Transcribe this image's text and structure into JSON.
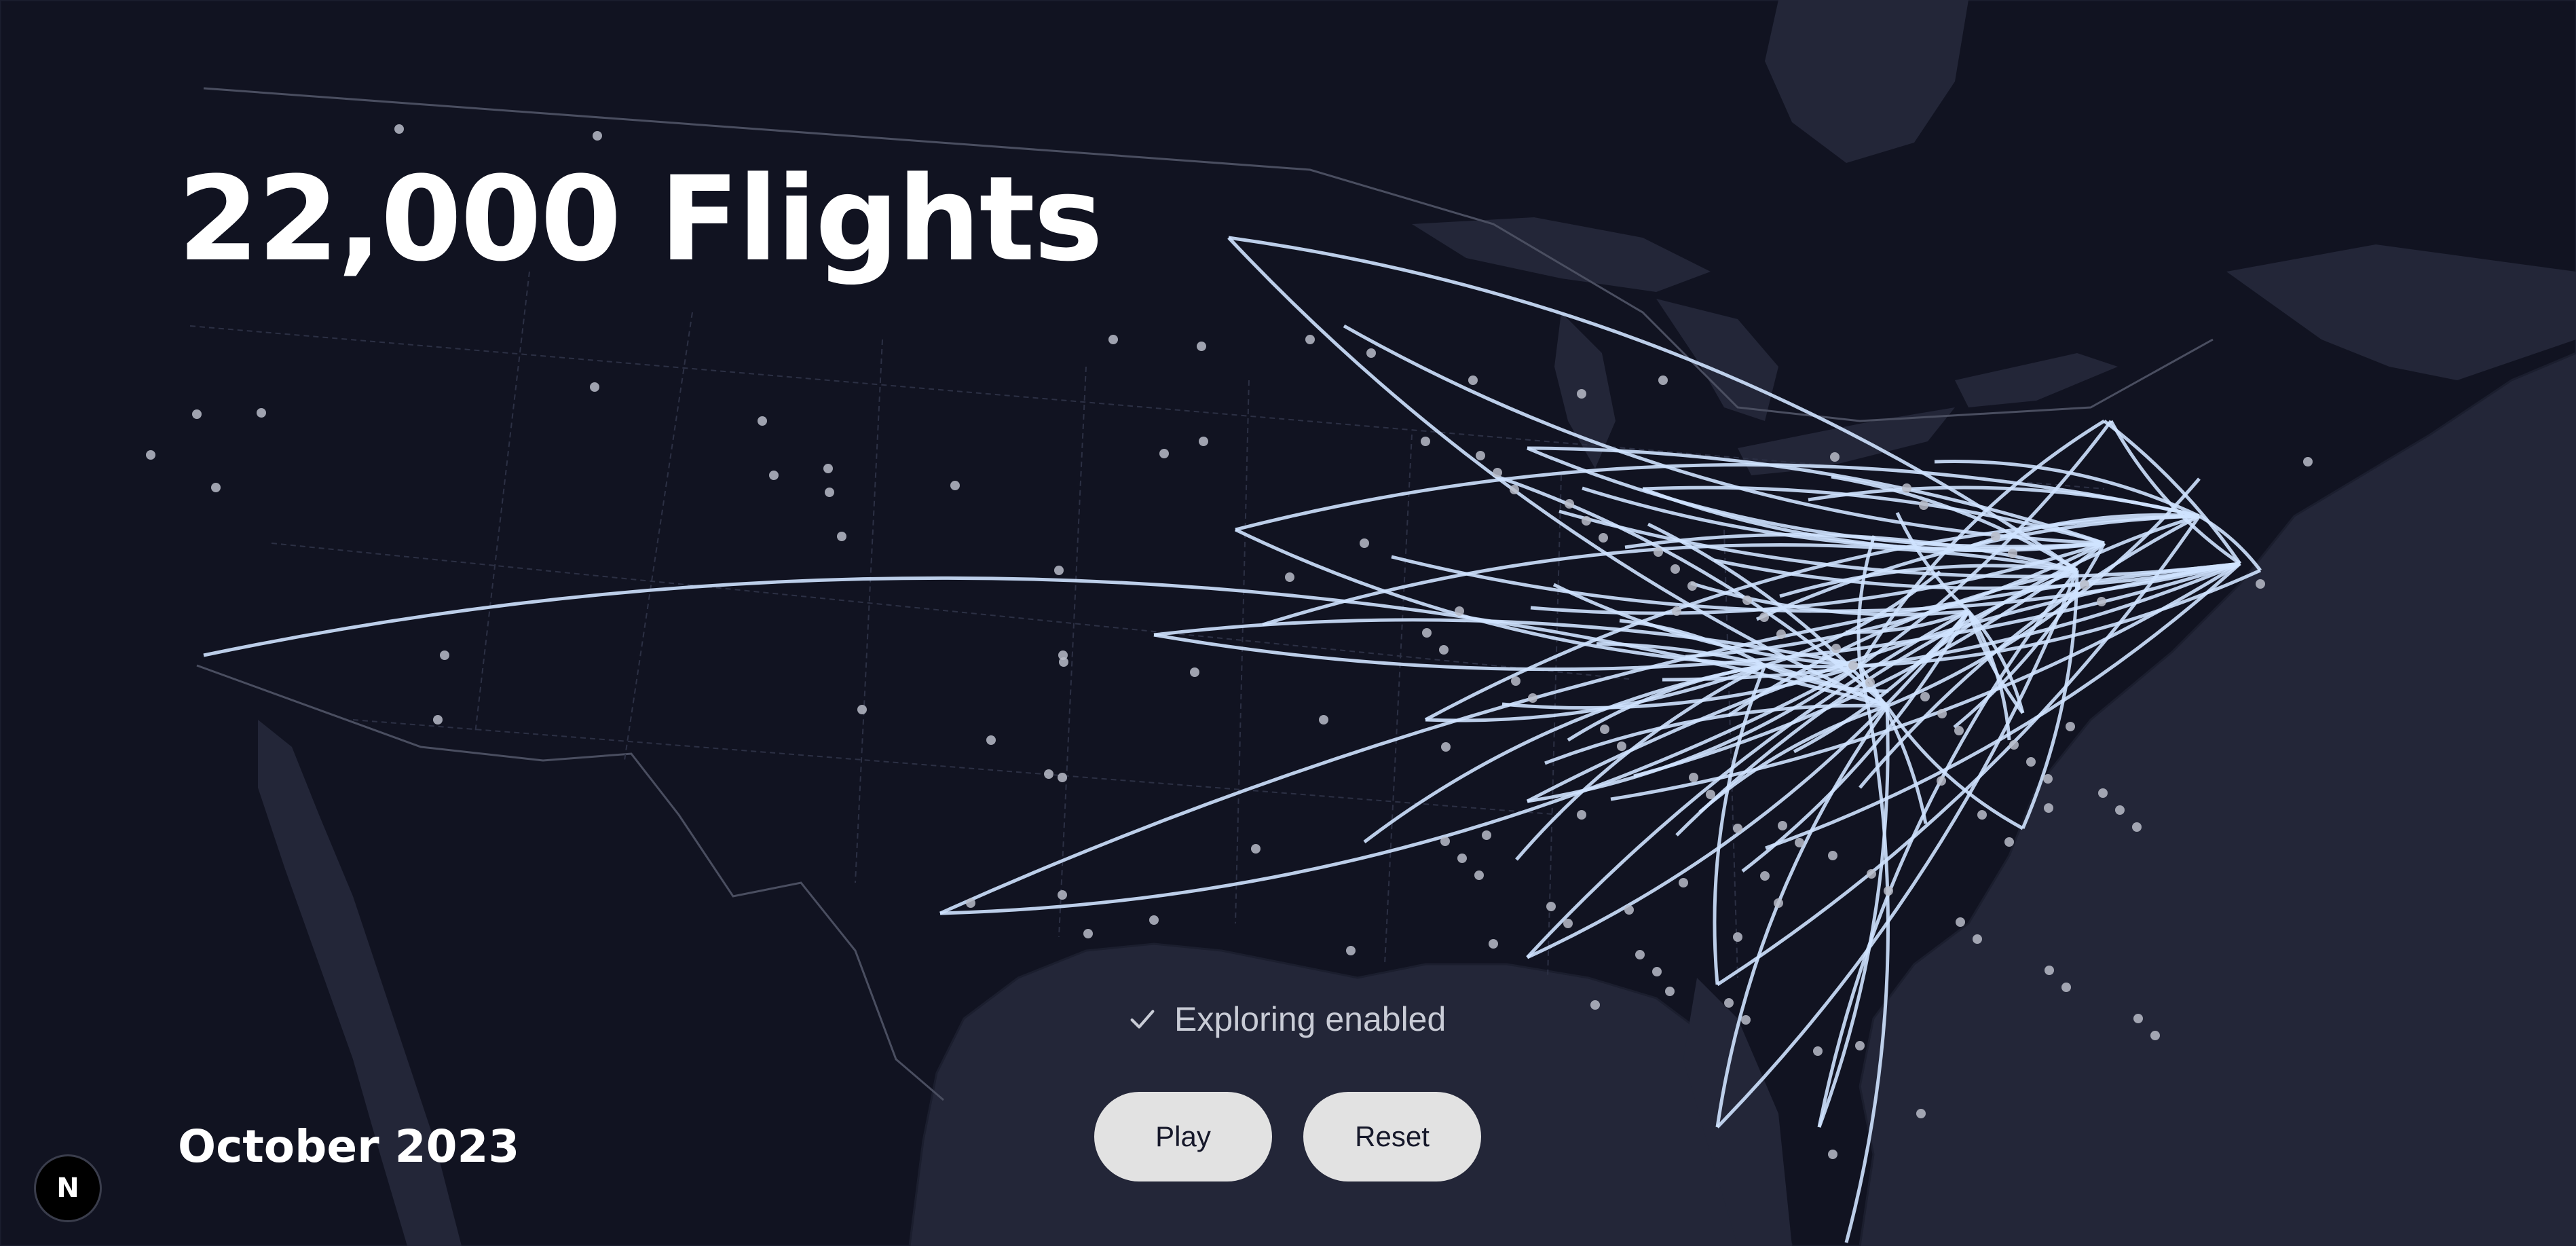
{
  "title": "22,000 Flights",
  "date_label": "October 2023",
  "status": {
    "text": "Exploring enabled",
    "icon": "check-icon"
  },
  "buttons": {
    "play": "Play",
    "reset": "Reset"
  },
  "badge": {
    "letter": "N"
  },
  "colors": {
    "water": "#232638",
    "land": "#111321",
    "border": "#4a4e60",
    "route": "#cfe3ff",
    "airport": "#b9bcc8"
  }
}
